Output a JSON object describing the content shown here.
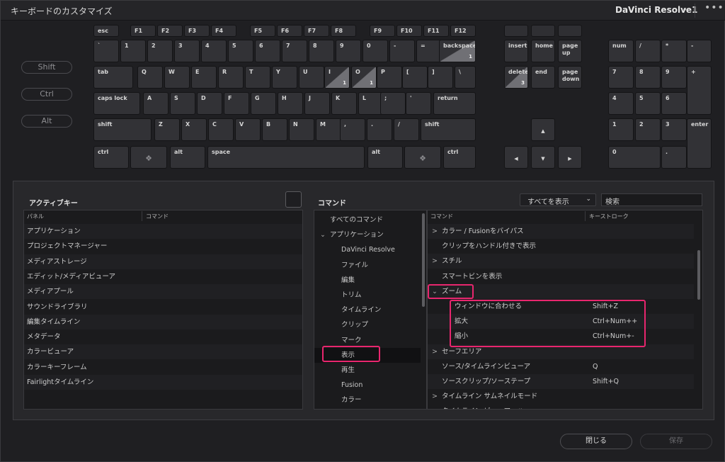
{
  "window": {
    "title": "キーボードのカスタマイズ",
    "preset_name": "DaVinci Resolve1",
    "preset_chevron": "⌄",
    "more_icon": "•••"
  },
  "modifiers": [
    "Shift",
    "Ctrl",
    "Alt"
  ],
  "keys": {
    "esc": "esc",
    "f1": "F1",
    "f2": "F2",
    "f3": "F3",
    "f4": "F4",
    "f5": "F5",
    "f6": "F6",
    "f7": "F7",
    "f8": "F8",
    "f9": "F9",
    "f10": "F10",
    "f11": "F11",
    "f12": "F12",
    "backtick": "`",
    "n1": "1",
    "n2": "2",
    "n3": "3",
    "n4": "4",
    "n5": "5",
    "n6": "6",
    "n7": "7",
    "n8": "8",
    "n9": "9",
    "n0": "0",
    "minus": "-",
    "equal": "=",
    "backspace": "backspace",
    "backspace_count": "1",
    "tab": "tab",
    "q": "Q",
    "w": "W",
    "e": "E",
    "r": "R",
    "t": "T",
    "y": "Y",
    "u": "U",
    "i": "I",
    "i_count": "1",
    "o": "O",
    "o_count": "1",
    "p": "P",
    "lbracket": "[",
    "rbracket": "]",
    "backslash": "\\",
    "capslock": "caps lock",
    "a": "A",
    "s": "S",
    "d": "D",
    "f": "F",
    "g": "G",
    "h": "H",
    "j": "J",
    "k": "K",
    "l": "L",
    "semicolon": ";",
    "quote": "'",
    "return": "return",
    "lshift": "shift",
    "z": "Z",
    "x": "X",
    "c": "C",
    "v": "V",
    "b": "B",
    "n": "N",
    "m": "M",
    "comma": ",",
    "period": ".",
    "slash": "/",
    "rshift": "shift",
    "lctrl": "ctrl",
    "lalt": "alt",
    "space": "space",
    "ralt": "alt",
    "rctrl": "ctrl",
    "insert": "insert",
    "home": "home",
    "pageup": "page up",
    "delete": "delete",
    "delete_count": "3",
    "end": "end",
    "pagedown": "page down",
    "up": "▲",
    "left": "◀",
    "down": "▼",
    "right": "▶",
    "num": "num",
    "num_div": "/",
    "num_mul": "*",
    "num_minus": "-",
    "num7": "7",
    "num8": "8",
    "num9": "9",
    "num_plus": "+",
    "num4": "4",
    "num5": "5",
    "num6": "6",
    "num1": "1",
    "num2": "2",
    "num3": "3",
    "enter": "enter",
    "num0": "0",
    "num_dot": "."
  },
  "active_keys": {
    "title": "アクティブキー",
    "col_panel": "パネル",
    "col_command": "コマンド",
    "rows": [
      "アプリケーション",
      "プロジェクトマネージャー",
      "メディアストレージ",
      "エディット/メディアビューア",
      "メディアプール",
      "サウンドライブラリ",
      "編集タイムライン",
      "メタデータ",
      "カラービューア",
      "カラーキーフレーム",
      "Fairlightタイムライン"
    ]
  },
  "commands": {
    "title": "コマンド",
    "filter_value": "すべてを表示",
    "filter_chevron": "⌄",
    "search_placeholder": "検索",
    "tree": [
      {
        "label": "すべてのコマンド",
        "arrow": ""
      },
      {
        "label": "アプリケーション",
        "arrow": "⌄"
      },
      {
        "label": "DaVinci Resolve",
        "arrow": ""
      },
      {
        "label": "ファイル",
        "arrow": ""
      },
      {
        "label": "編集",
        "arrow": ""
      },
      {
        "label": "トリム",
        "arrow": ""
      },
      {
        "label": "タイムライン",
        "arrow": ""
      },
      {
        "label": "クリップ",
        "arrow": ""
      },
      {
        "label": "マーク",
        "arrow": ""
      },
      {
        "label": "表示",
        "arrow": ""
      },
      {
        "label": "再生",
        "arrow": ""
      },
      {
        "label": "Fusion",
        "arrow": ""
      },
      {
        "label": "カラー",
        "arrow": ""
      }
    ],
    "col_command": "コマンド",
    "col_keystroke": "キーストローク",
    "list": [
      {
        "arrow": ">",
        "label": "カラー / Fusionをバイパス",
        "key": ""
      },
      {
        "arrow": "",
        "label": "クリップをハンドル付きで表示",
        "key": ""
      },
      {
        "arrow": ">",
        "label": "スチル",
        "key": ""
      },
      {
        "arrow": "",
        "label": "スマートビンを表示",
        "key": ""
      },
      {
        "arrow": "⌄",
        "label": "ズーム",
        "key": ""
      },
      {
        "arrow": "",
        "label": "ウィンドウに合わせる",
        "key": "Shift+Z"
      },
      {
        "arrow": "",
        "label": "拡大",
        "key": "Ctrl+Num++"
      },
      {
        "arrow": "",
        "label": "縮小",
        "key": "Ctrl+Num+-"
      },
      {
        "arrow": ">",
        "label": "セーフエリア",
        "key": ""
      },
      {
        "arrow": "",
        "label": "ソース/タイムラインビューア",
        "key": "Q"
      },
      {
        "arrow": "",
        "label": "ソースクリップ/ソーステープ",
        "key": "Shift+Q"
      },
      {
        "arrow": ">",
        "label": "タイムライン サムネイルモード",
        "key": ""
      }
    ],
    "partial_row": "タイムライン ビューア・ハ・・・"
  },
  "buttons": {
    "close": "閉じる",
    "save": "保存"
  },
  "colors": {
    "highlight": "#e8266e",
    "background": "#1f1f22"
  }
}
